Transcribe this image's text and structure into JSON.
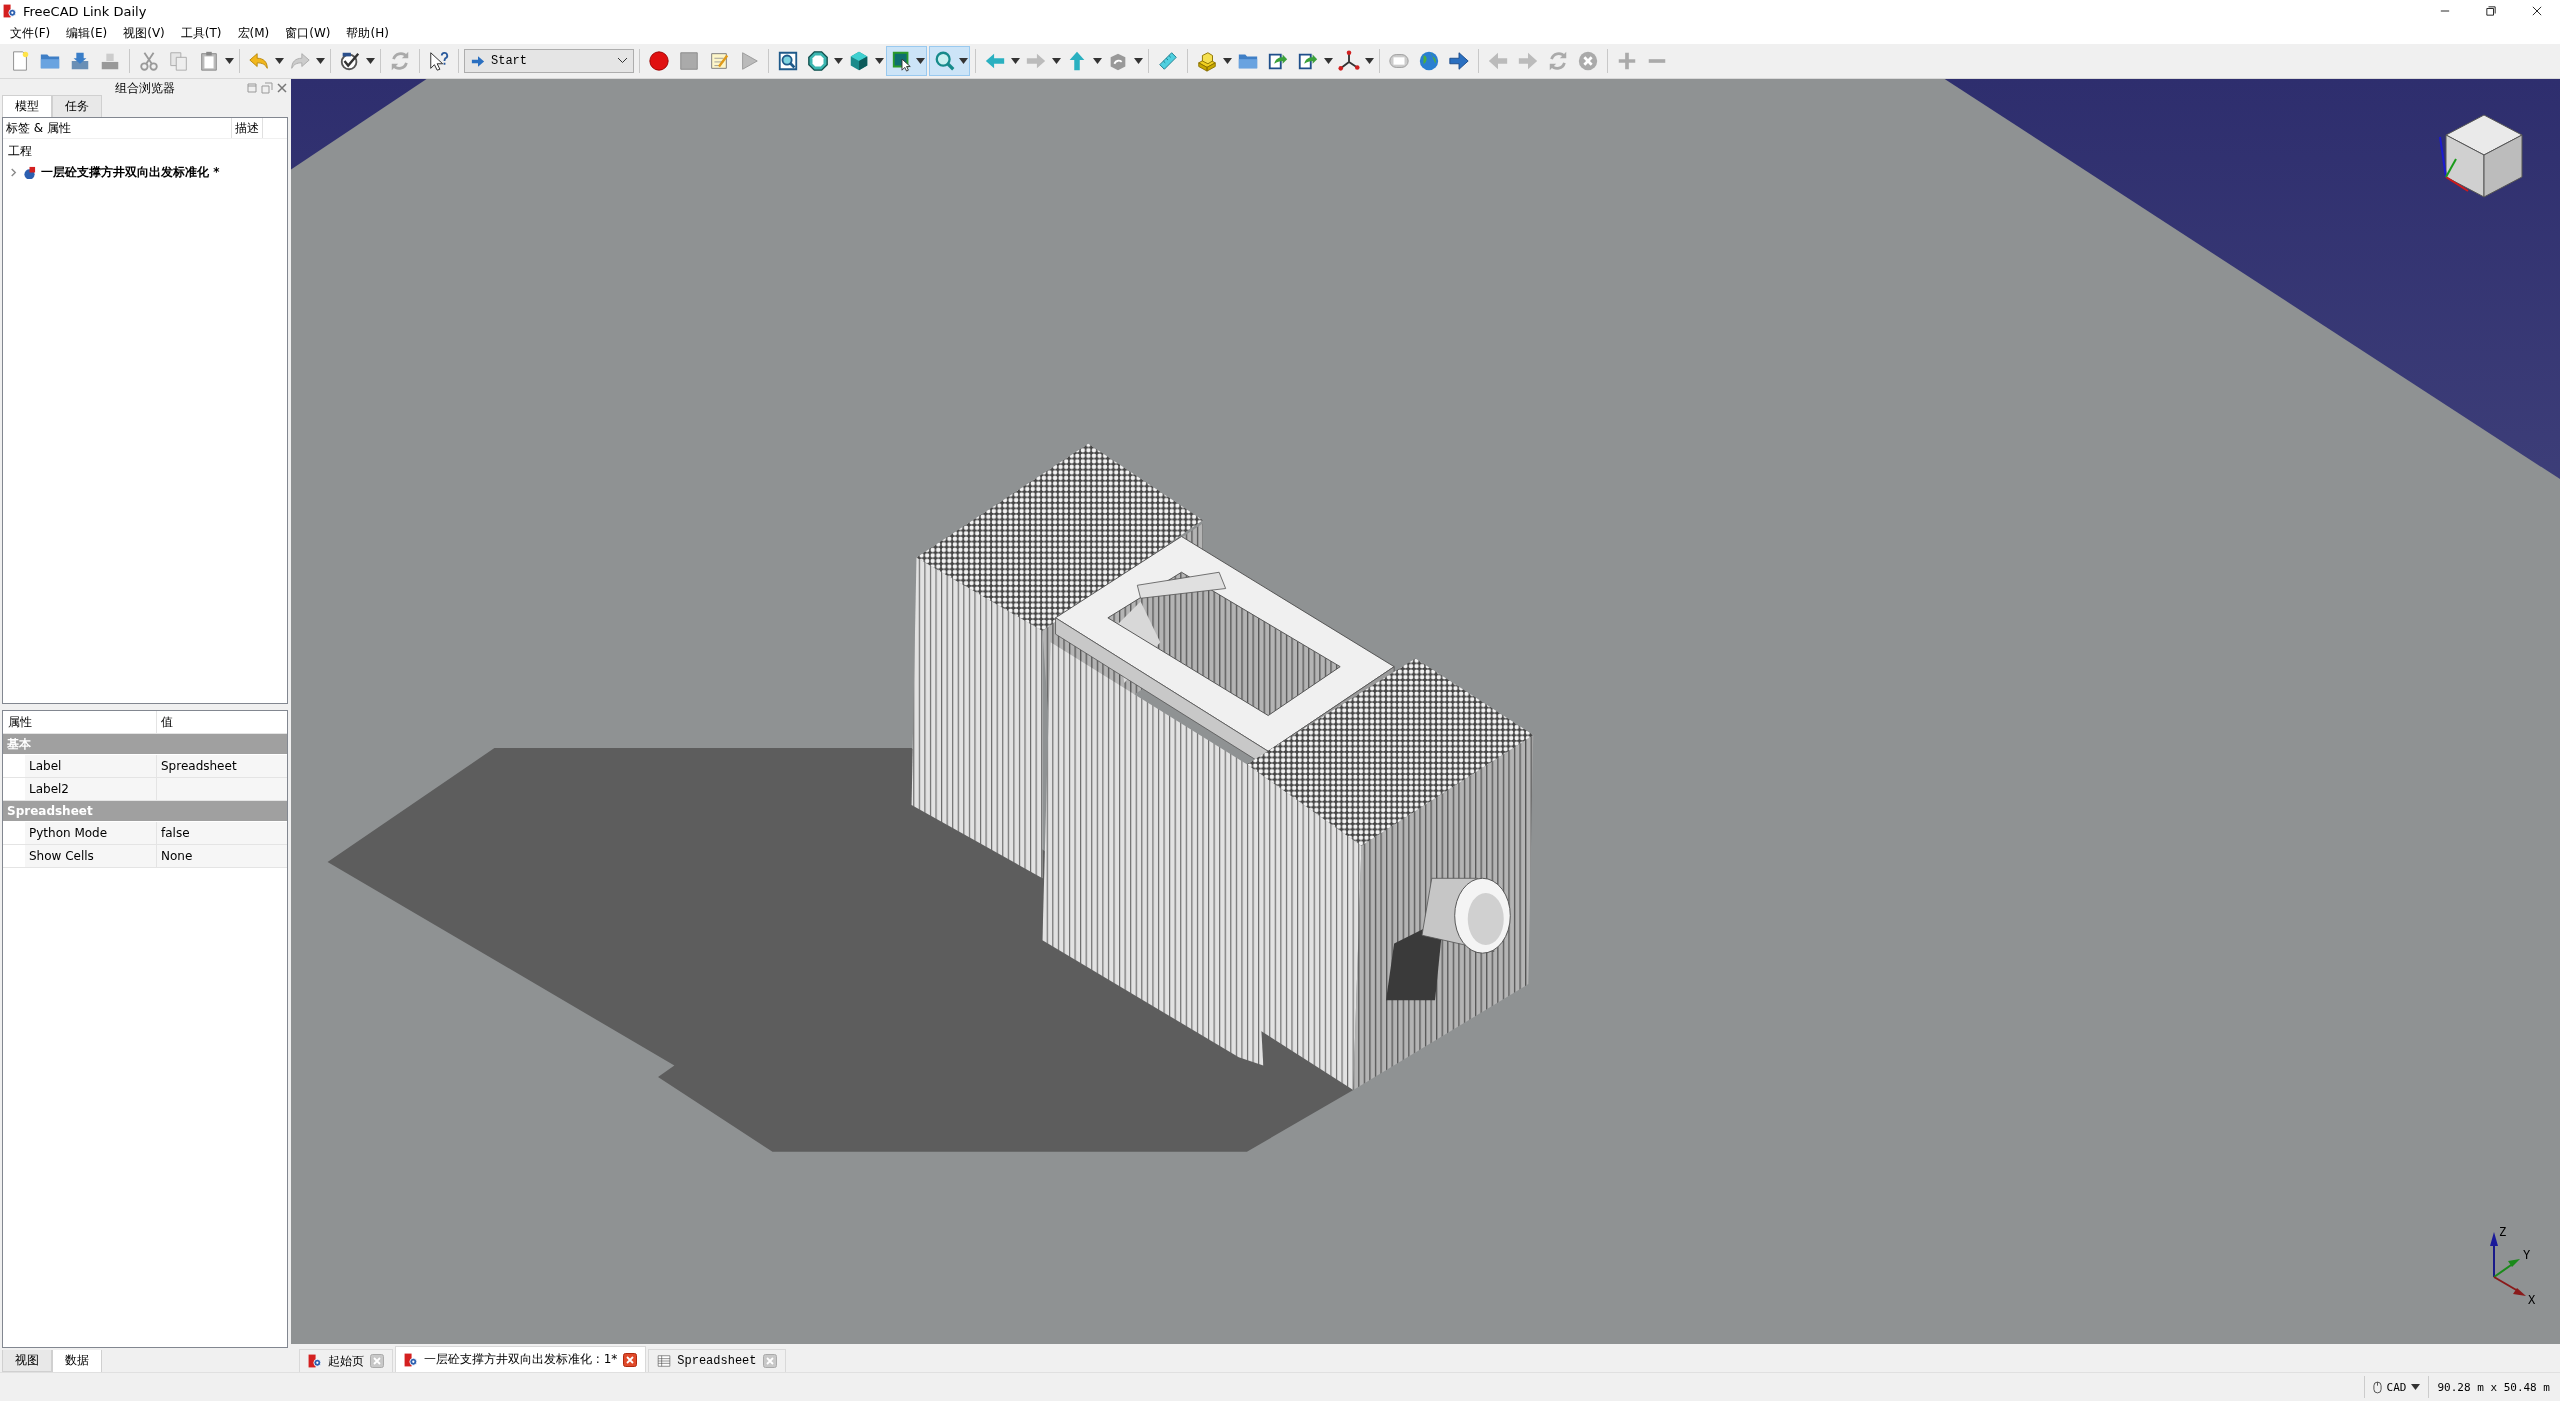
{
  "window": {
    "title": "FreeCAD Link Daily"
  },
  "menu": [
    "文件(F)",
    "编辑(E)",
    "视图(V)",
    "工具(T)",
    "宏(M)",
    "窗口(W)",
    "帮助(H)"
  ],
  "toolbar": {
    "workbench": "Start"
  },
  "combo_view": {
    "title": "组合浏览器",
    "tabs": [
      {
        "label": "模型",
        "selected": true
      },
      {
        "label": "任务",
        "selected": false
      }
    ],
    "tree": {
      "columns": [
        "标签 & 属性",
        "描述"
      ],
      "root": "工程",
      "items": [
        {
          "label": "一层砼支撑方井双向出发标准化 *",
          "expanded": false
        }
      ]
    },
    "properties": {
      "columns": [
        "属性",
        "值"
      ],
      "groups": [
        {
          "name": "基本",
          "rows": [
            {
              "name": "Label",
              "value": "Spreadsheet"
            },
            {
              "name": "Label2"
            }
          ]
        },
        {
          "name": "Spreadsheet",
          "rows": [
            {
              "name": "Python Mode",
              "value": "false"
            },
            {
              "name": "Show Cells",
              "value": "None"
            }
          ]
        }
      ]
    },
    "bottom_tabs": [
      {
        "label": "视图",
        "selected": false
      },
      {
        "label": "数据",
        "selected": true
      }
    ]
  },
  "viewport": {
    "axis_triad": [
      {
        "kind": "z",
        "label": "Z"
      },
      {
        "kind": "y",
        "label": "Y"
      },
      {
        "kind": "x",
        "label": "X"
      }
    ]
  },
  "document_tabs": [
    {
      "label": "起始页",
      "kind": "start",
      "selected": false
    },
    {
      "label": "一层砼支撑方井双向出发标准化 : 1*",
      "kind": "document",
      "selected": true
    },
    {
      "label": "Spreadsheet",
      "kind": "spreadsheet",
      "selected": false
    }
  ],
  "status_bar": {
    "navigation_style": "CAD",
    "dimensions": "90.28 m x 50.48 m"
  }
}
